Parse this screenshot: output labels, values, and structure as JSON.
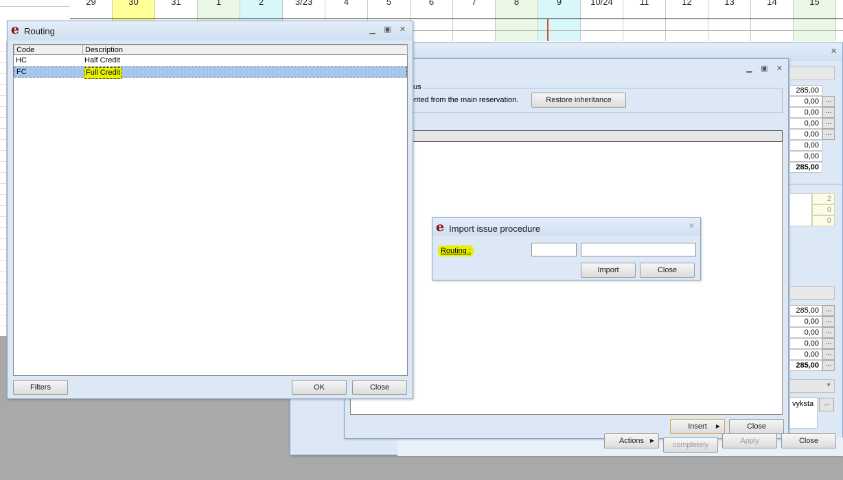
{
  "calendar": {
    "days": [
      "29",
      "30",
      "31",
      "1",
      "2",
      "3/23",
      "4",
      "5",
      "6",
      "7",
      "8",
      "9",
      "10/24",
      "11",
      "12",
      "13",
      "14",
      "15"
    ],
    "weekend_color": "#eaf7e4",
    "today_color": "#ffff99",
    "highlight_color": "#d8f7fa"
  },
  "back_window": {
    "section_label_fragment": "us",
    "inherit_text_fragment": "erited from the main reservation.",
    "restore_button": "Restore inheritance",
    "insert_button": "Insert",
    "close_button": "Close",
    "totals_top": [
      "285,00",
      "0,00",
      "0,00",
      "0,00",
      "0,00",
      "0,00",
      "0,00",
      "285,00"
    ],
    "counts": [
      "2",
      "0",
      "0"
    ],
    "totals_bottom": [
      "285,00",
      "0,00",
      "0,00",
      "0,00",
      "0,00",
      "285,00"
    ],
    "text_fragment": "vyksta",
    "bottom_buttons": {
      "actions": "Actions",
      "completely": "completely",
      "apply": "Apply",
      "close": "Close"
    },
    "ellipsis": "..."
  },
  "routing_window": {
    "title": "Routing",
    "columns": [
      "Code",
      "Description"
    ],
    "rows": [
      {
        "code": "HC",
        "description": "Half Credit"
      },
      {
        "code": "FC",
        "description": "Full Credit"
      }
    ],
    "filters_button": "Filters",
    "ok_button": "OK",
    "close_button": "Close"
  },
  "import_dialog": {
    "title": "Import issue procedure",
    "routing_label": "Routing :",
    "routing_code_value": "",
    "routing_desc_value": "",
    "import_button": "Import",
    "close_button": "Close"
  },
  "colors": {
    "highlight": "#e8f000",
    "selection": "#a6c8ee",
    "logo": "#8a0a0a"
  }
}
